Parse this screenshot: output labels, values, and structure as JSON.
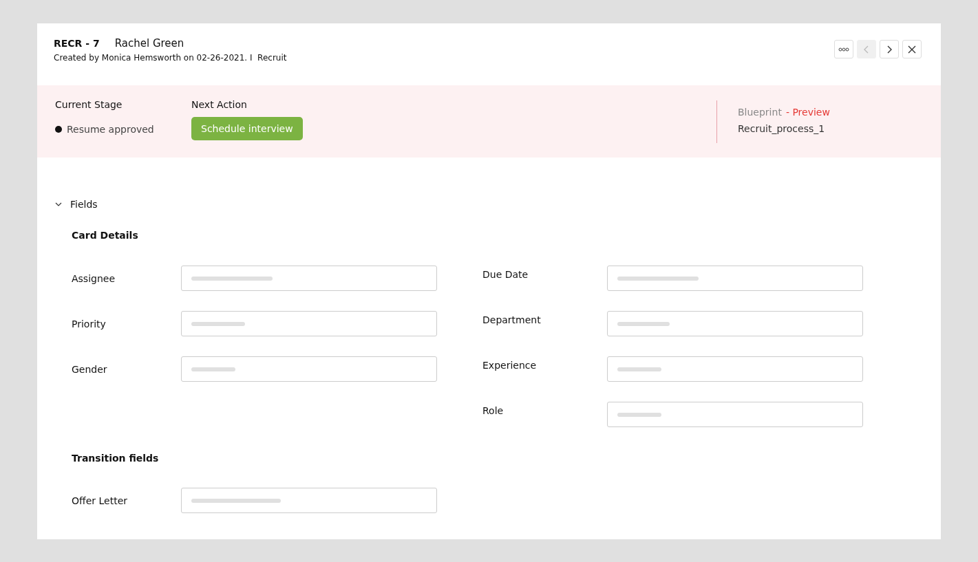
{
  "header": {
    "record_id": "RECR - 7",
    "name": "Rachel Green",
    "created": "Created by Monica Hemsworth on 02-26-2021. I  Recruit"
  },
  "toolbar": [
    {
      "kind": "more",
      "disabled": false
    },
    {
      "kind": "prev",
      "disabled": true
    },
    {
      "kind": "next",
      "disabled": false
    },
    {
      "kind": "close",
      "disabled": false
    }
  ],
  "stage": {
    "current_label": "Current Stage",
    "current_value": "Resume approved",
    "next_label": "Next Action",
    "next_button": "Schedule interview",
    "blueprint_label": "Blueprint",
    "blueprint_tag": "- Preview",
    "blueprint_value": "Recruit_process_1"
  },
  "fields": {
    "title": "Fields",
    "expanded": true,
    "card_details": {
      "heading": "Card Details",
      "left": [
        {
          "label": "Assignee"
        },
        {
          "label": "Priority"
        },
        {
          "label": "Gender"
        }
      ],
      "right": [
        {
          "label": "Due Date"
        },
        {
          "label": "Department"
        },
        {
          "label": "Experience"
        },
        {
          "label": "Role"
        }
      ]
    },
    "transition": {
      "heading": "Transition fields",
      "rows": [
        {
          "label": "Offer Letter"
        }
      ]
    }
  }
}
